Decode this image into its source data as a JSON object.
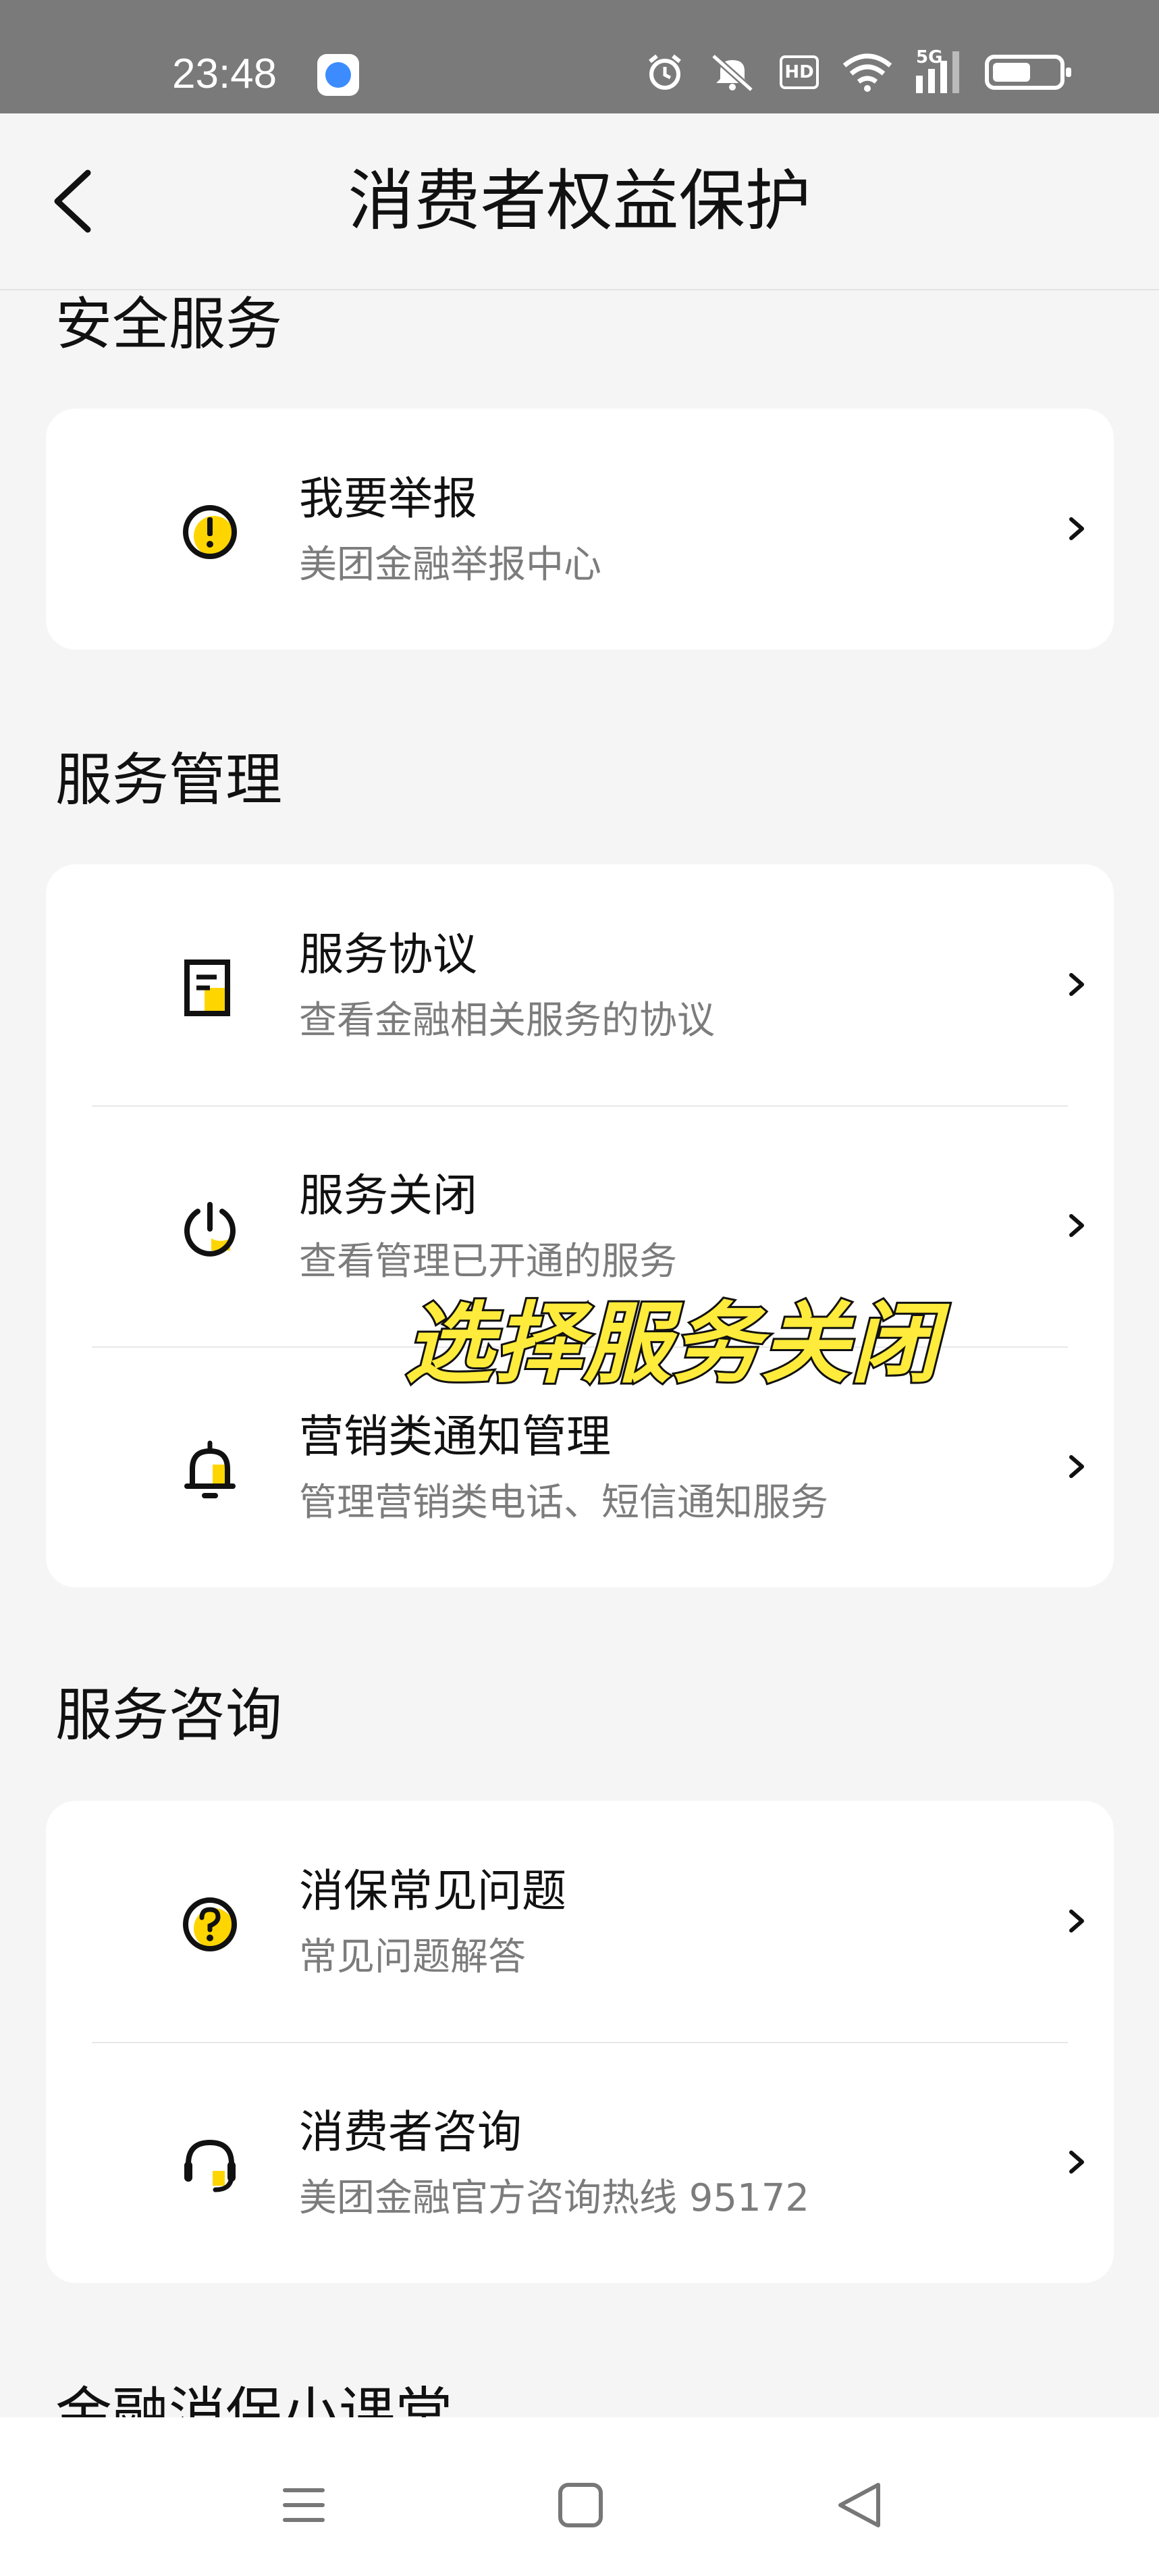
{
  "status_bar": {
    "time": "23:48",
    "icons": [
      "app-badge-icon",
      "alarm-icon",
      "mute-icon",
      "hd-icon",
      "wifi-icon",
      "5g-signal-icon",
      "battery-icon"
    ],
    "hd_label": "HD",
    "signal_label": "5G"
  },
  "header": {
    "title": "消费者权益保护"
  },
  "sections": [
    {
      "title": "安全服务",
      "items": [
        {
          "title": "我要举报",
          "subtitle": "美团金融举报中心",
          "icon": "warning-icon"
        }
      ]
    },
    {
      "title": "服务管理",
      "items": [
        {
          "title": "服务协议",
          "subtitle": "查看金融相关服务的协议",
          "icon": "document-icon"
        },
        {
          "title": "服务关闭",
          "subtitle": "查看管理已开通的服务",
          "icon": "power-icon"
        },
        {
          "title": "营销类通知管理",
          "subtitle": "管理营销类电话、短信通知服务",
          "icon": "bell-icon"
        }
      ]
    },
    {
      "title": "服务咨询",
      "items": [
        {
          "title": "消保常见问题",
          "subtitle": "常见问题解答",
          "icon": "question-icon"
        },
        {
          "title": "消费者咨询",
          "subtitle": "美团金融官方咨询热线 95172",
          "icon": "headset-icon"
        }
      ]
    }
  ],
  "next_section_title": "金融消保小课堂",
  "overlay_caption": "选择服务关闭",
  "colors": {
    "accent": "#ffd500",
    "caption": "#ffeb3b",
    "background": "#f5f5f5"
  },
  "bottom_nav": [
    "menu-icon",
    "home-icon",
    "back-triangle-icon"
  ]
}
